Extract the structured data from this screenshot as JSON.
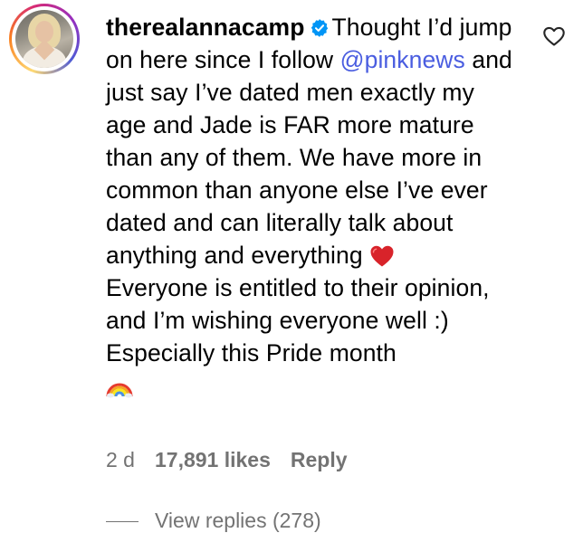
{
  "comment": {
    "username": "therealannacamp",
    "verified": true,
    "text_part1": "Thought I’d jump on here since I follow ",
    "mention": "@pinknews",
    "text_part2": " and just say I’ve dated men exactly my age and Jade is FAR more mature than any of them. We have more in common than anyone else I’ve ever dated and can literally talk about anything and everything ",
    "emoji_heart": "red-heart",
    "text_part3": " Everyone is entitled to their opinion, and I’m wishing everyone well :) Especially this Pride month ",
    "emoji_rainbow": "rainbow",
    "time_ago": "2 d",
    "likes": "17,891 likes",
    "reply_label": "Reply",
    "view_replies": "View replies (278)"
  },
  "icons": {
    "like": "heart-outline-icon",
    "verified": "verified-badge-icon"
  },
  "colors": {
    "mention": "#4a5de0",
    "meta": "#737373",
    "verified": "#0095f6",
    "heart_emoji": "#d8232a"
  }
}
